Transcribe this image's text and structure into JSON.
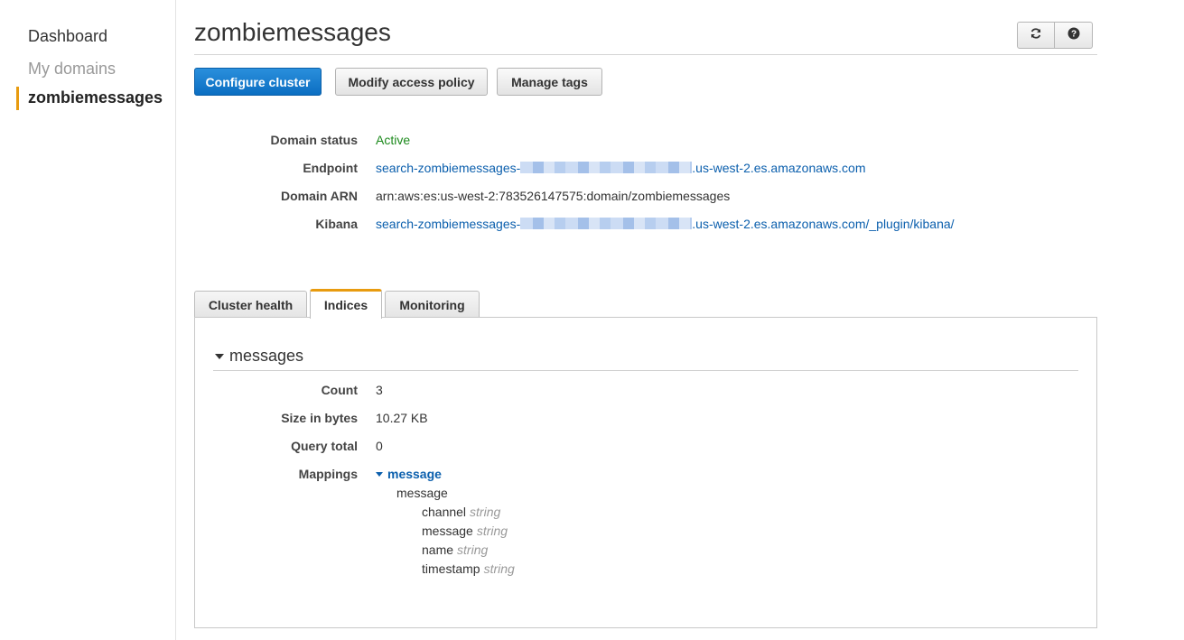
{
  "sidebar": {
    "items": [
      {
        "label": "Dashboard"
      },
      {
        "label": "My domains"
      },
      {
        "label": "zombiemessages"
      }
    ]
  },
  "header": {
    "title": "zombiemessages",
    "refresh_icon": "refresh-icon",
    "help_icon": "help-icon"
  },
  "actions": {
    "configure": "Configure cluster",
    "modify": "Modify access policy",
    "tags": "Manage tags"
  },
  "details": {
    "status_label": "Domain status",
    "status_value": "Active",
    "endpoint_label": "Endpoint",
    "endpoint_prefix": "search-zombiemessages-",
    "endpoint_suffix": ".us-west-2.es.amazonaws.com",
    "arn_label": "Domain ARN",
    "arn_value": "arn:aws:es:us-west-2:783526147575:domain/zombiemessages",
    "kibana_label": "Kibana",
    "kibana_prefix": "search-zombiemessages-",
    "kibana_suffix": ".us-west-2.es.amazonaws.com/_plugin/kibana/"
  },
  "tabs": [
    {
      "label": "Cluster health"
    },
    {
      "label": "Indices"
    },
    {
      "label": "Monitoring"
    }
  ],
  "index": {
    "name": "messages",
    "count_label": "Count",
    "count_value": "3",
    "size_label": "Size in bytes",
    "size_value": "10.27 KB",
    "query_label": "Query total",
    "query_value": "0",
    "mappings_label": "Mappings",
    "mapping_toggle": "message",
    "mapping_type": "message",
    "fields": [
      {
        "name": "channel",
        "type": "string"
      },
      {
        "name": "message",
        "type": "string"
      },
      {
        "name": "name",
        "type": "string"
      },
      {
        "name": "timestamp",
        "type": "string"
      }
    ]
  },
  "colors": {
    "accent": "#e89b0f",
    "primary": "#0b6ec2",
    "link": "#0b5fad",
    "active": "#1d8a1d"
  }
}
